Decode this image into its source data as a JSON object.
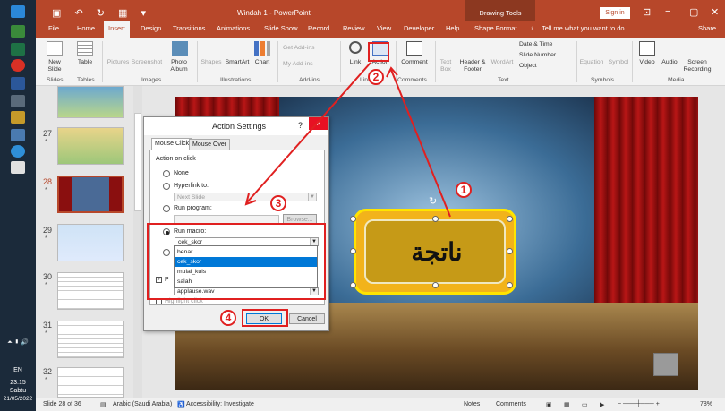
{
  "window": {
    "title": "Windah 1 - PowerPoint",
    "context_tab_group": "Drawing Tools",
    "sign_in": "Sign in",
    "tell_me": "Tell me what you want to do",
    "share": "Share"
  },
  "tabs": [
    "File",
    "Home",
    "Insert",
    "Design",
    "Transitions",
    "Animations",
    "Slide Show",
    "Record",
    "Review",
    "View",
    "Developer",
    "Help",
    "Shape Format"
  ],
  "active_tab": "Insert",
  "ribbon": {
    "new_slide": "New Slide",
    "table": "Table",
    "pictures": "Pictures",
    "screenshot": "Screenshot",
    "photo_album": "Photo Album",
    "shapes": "Shapes",
    "smartart": "SmartArt",
    "chart": "Chart",
    "get_addins": "Get Add-ins",
    "my_addins": "My Add-ins",
    "link": "Link",
    "action": "Action",
    "comment": "Comment",
    "text_box": "Text Box",
    "header_footer": "Header & Footer",
    "wordart": "WordArt",
    "date_time": "Date & Time",
    "slide_number": "Slide Number",
    "object": "Object",
    "equation": "Equation",
    "symbol": "Symbol",
    "video": "Video",
    "audio": "Audio",
    "screen_recording": "Screen Recording",
    "groups": {
      "slides": "Slides",
      "tables": "Tables",
      "images": "Images",
      "illustrations": "Illustrations",
      "addins": "Add-ins",
      "links": "Links",
      "comments": "Comments",
      "text": "Text",
      "symbols": "Symbols",
      "media": "Media"
    }
  },
  "thumbnails": [
    {
      "num": "27",
      "star": "*"
    },
    {
      "num": "28",
      "star": "*"
    },
    {
      "num": "29",
      "star": "*"
    },
    {
      "num": "30",
      "star": "*"
    },
    {
      "num": "31",
      "star": "*"
    },
    {
      "num": "32",
      "star": "*"
    }
  ],
  "slide": {
    "button_text": "ناتجة"
  },
  "dialog": {
    "title": "Action Settings",
    "help": "?",
    "close": "×",
    "tabs": [
      "Mouse Click",
      "Mouse Over"
    ],
    "action_on_click": "Action on click",
    "none": "None",
    "hyperlink_to": "Hyperlink to:",
    "hyperlink_value": "Next Slide",
    "run_program": "Run program:",
    "browse": "Browse...",
    "run_macro": "Run macro:",
    "macro_value": "cek_skor",
    "macro_options": [
      "benar",
      "cek_skor",
      "mulai_kuis",
      "salah"
    ],
    "macro_selected_index": 1,
    "play_sound_prefix": "P",
    "sound_value": "applause.wav",
    "highlight_click": "Highlight click",
    "ok": "OK",
    "cancel": "Cancel"
  },
  "callouts": [
    "1",
    "2",
    "3",
    "4"
  ],
  "taskbar": {
    "time": "23:15",
    "day": "Sabtu",
    "date": "21/05/2022",
    "lang": "EN"
  },
  "status": {
    "slide_info": "Slide 28 of 36",
    "language": "Arabic (Saudi Arabia)",
    "accessibility": "Accessibility: Investigate",
    "notes": "Notes",
    "comments": "Comments",
    "zoom": "78%"
  },
  "colors": {
    "accent": "#b7472a",
    "annotation": "#e02020",
    "shape_fill": "#c69a17",
    "selection": "#0078d7"
  }
}
